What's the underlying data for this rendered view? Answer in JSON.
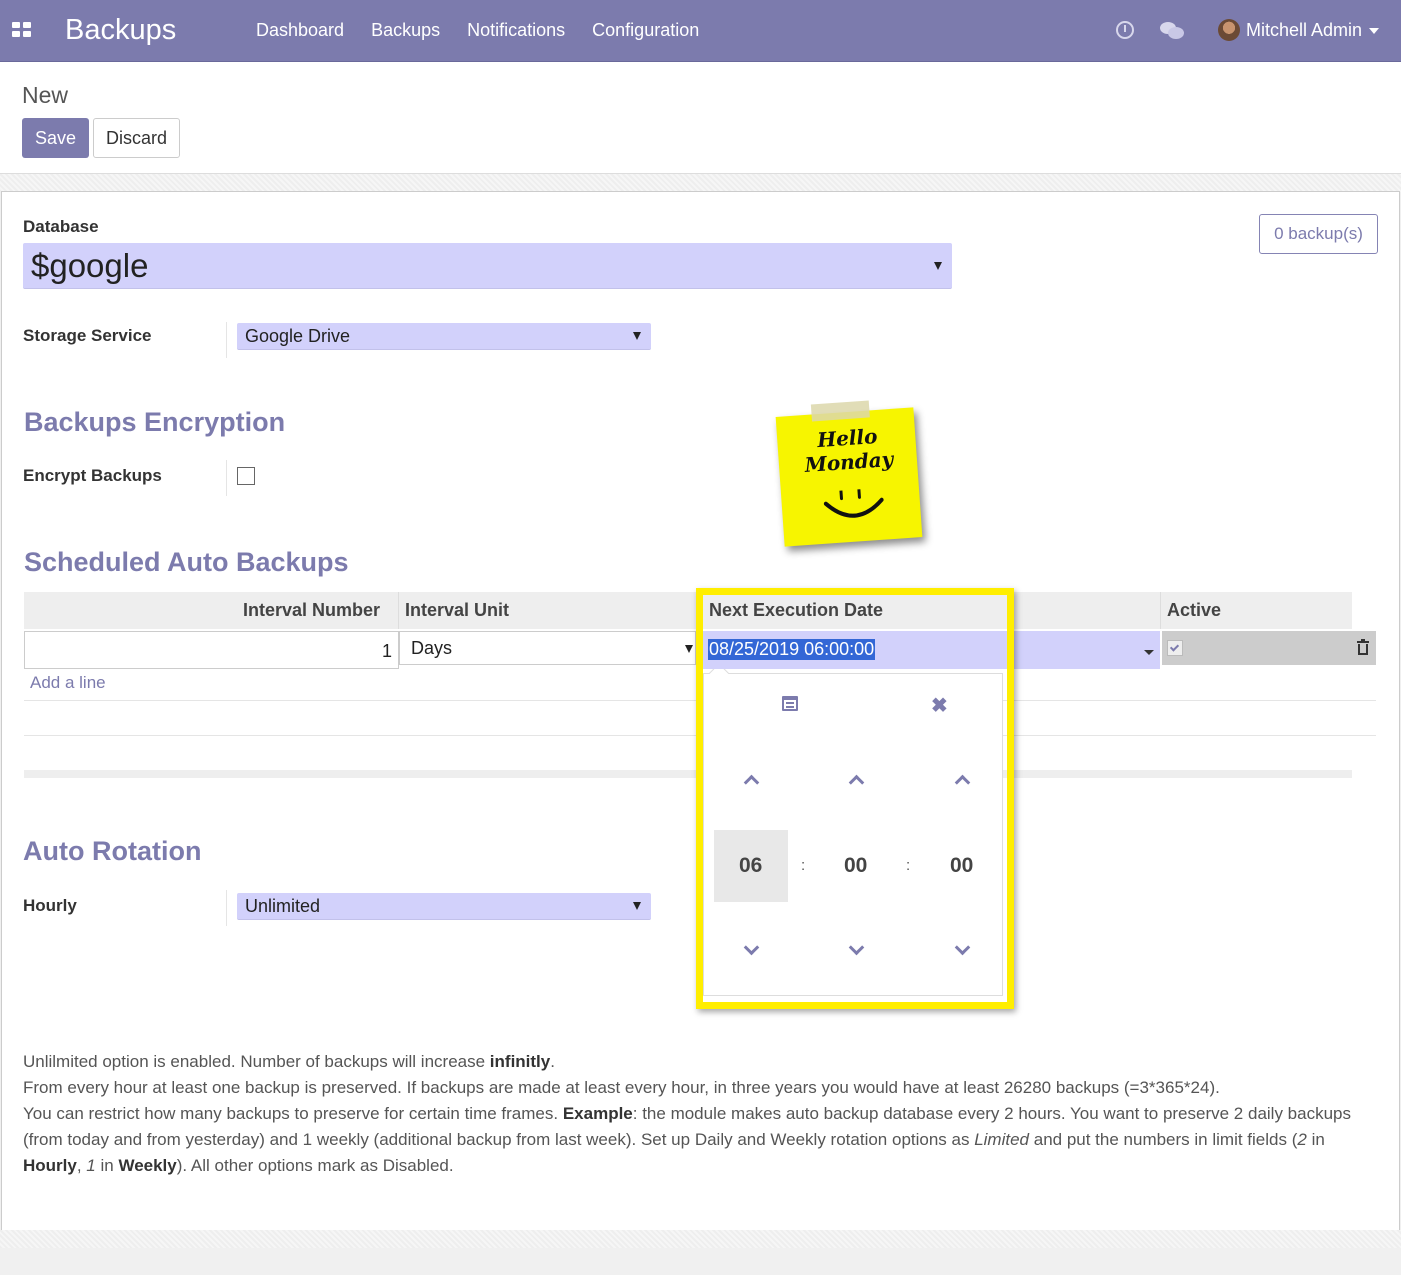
{
  "navbar": {
    "app_title": "Backups",
    "menu": [
      "Dashboard",
      "Backups",
      "Notifications",
      "Configuration"
    ],
    "user_name": "Mitchell Admin"
  },
  "control_panel": {
    "breadcrumb": "New",
    "save_label": "Save",
    "discard_label": "Discard"
  },
  "form": {
    "database_label": "Database",
    "database_value": "$google",
    "backups_stat": "0 backup(s)",
    "storage_label": "Storage Service",
    "storage_value": "Google Drive",
    "encryption_title": "Backups Encryption",
    "encrypt_label": "Encrypt Backups",
    "encrypt_checked": false,
    "scheduled_title": "Scheduled Auto Backups",
    "table": {
      "headers": [
        "Interval Number",
        "Interval Unit",
        "Next Execution Date",
        "Active"
      ],
      "row": {
        "interval_number": "1",
        "interval_unit": "Days",
        "next_execution": "08/25/2019 06:00:00",
        "active": true
      },
      "add_line": "Add a line"
    },
    "datepicker": {
      "hours": "06",
      "minutes": "00",
      "seconds": "00",
      "separator": ":"
    },
    "rotation_title": "Auto Rotation",
    "hourly_label": "Hourly",
    "hourly_value": "Unlimited"
  },
  "sticky_note": {
    "line1": "Hello",
    "line2": "Monday"
  },
  "help": {
    "p1_a": "Unlilmited option is enabled. Number of backups will increase ",
    "p1_b": "infinitly",
    "p1_c": ".",
    "p2": "From every hour at least one backup is preserved. If backups are made at least every hour, in three years you would have at least 26280 backups (=3*365*24).",
    "p3_a": "You can restrict how many backups to preserve for certain time frames. ",
    "p3_b": "Example",
    "p3_c": ": the module makes auto backup database every 2 hours. You want to preserve 2 daily backups (from today and from yesterday) and 1 weekly (additional backup from last week). Set up Daily and Weekly rotation options as ",
    "p3_d": "Limited",
    "p3_e": " and put the numbers in limit fields (",
    "p3_f": "2",
    "p3_g": " in ",
    "p3_h": "Hourly",
    "p3_i": ", ",
    "p3_j": "1",
    "p3_k": " in ",
    "p3_l": "Weekly",
    "p3_m": "). All other options mark as Disabled."
  },
  "colors": {
    "brand": "#7c7bad",
    "field_bg": "#d2d1fb",
    "highlight": "#ffee00",
    "sticky": "#f7f500"
  }
}
